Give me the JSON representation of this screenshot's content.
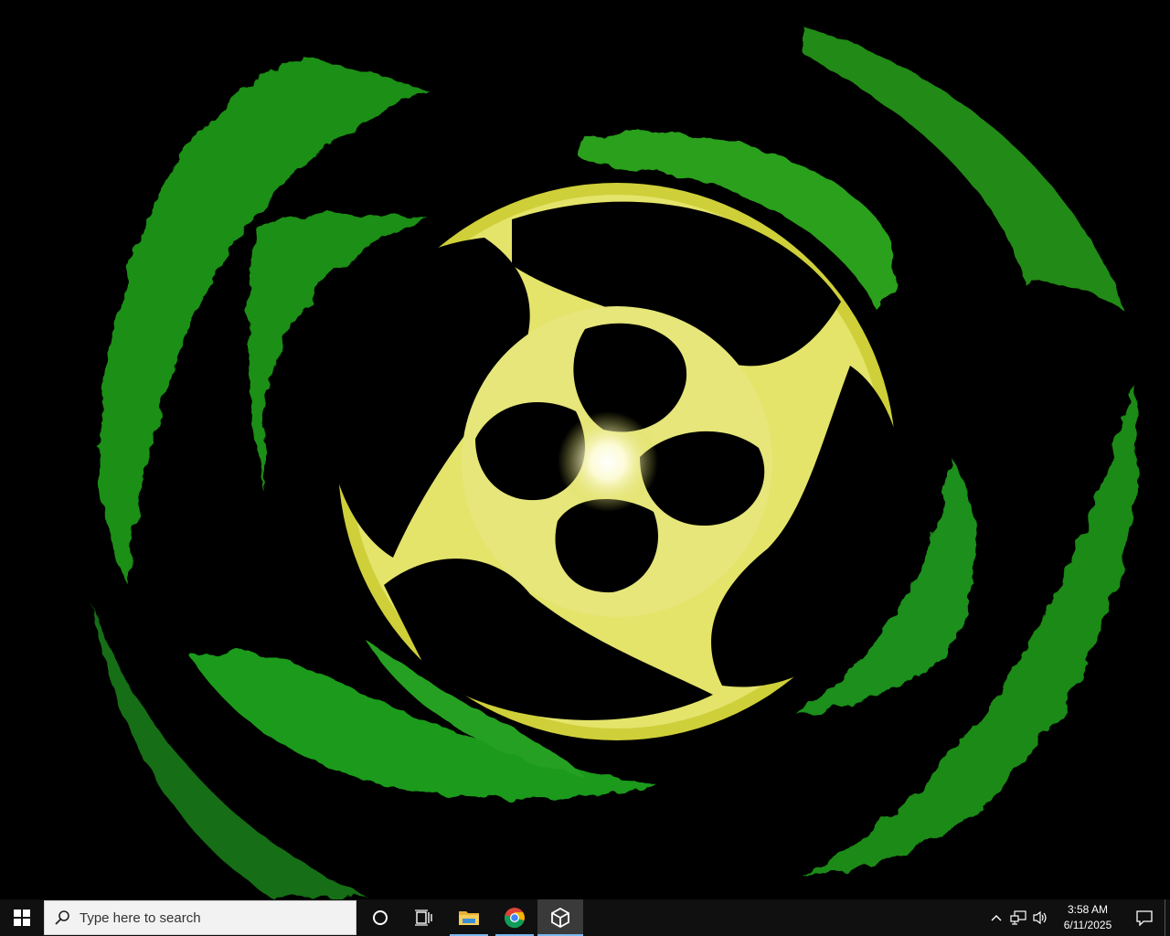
{
  "desktop": {
    "wallpaper": "green and yellow swirl abstract wallpaper",
    "colors": {
      "outer": "#1f8f1a",
      "inner": "#d9d94a",
      "center": "#ffffe6",
      "background": "#000000"
    }
  },
  "taskbar": {
    "start_icon": "windows-logo-icon",
    "search": {
      "placeholder": "Type here to search",
      "icon": "search-icon"
    },
    "cortana_icon": "cortana-circle-icon",
    "taskview_icon": "task-view-icon",
    "apps": [
      {
        "name": "File Explorer",
        "icon": "folder-icon",
        "state": "running"
      },
      {
        "name": "Google Chrome",
        "icon": "chrome-icon",
        "state": "running"
      },
      {
        "name": "Unity Hub",
        "icon": "unity-icon",
        "state": "focused"
      }
    ],
    "tray": {
      "icons": [
        "chevron-up-icon",
        "network-icon",
        "volume-icon"
      ],
      "time": "3:58 AM",
      "date": "6/11/2025",
      "notification_icon": "action-center-icon"
    },
    "accent": "#7ab8f0"
  }
}
